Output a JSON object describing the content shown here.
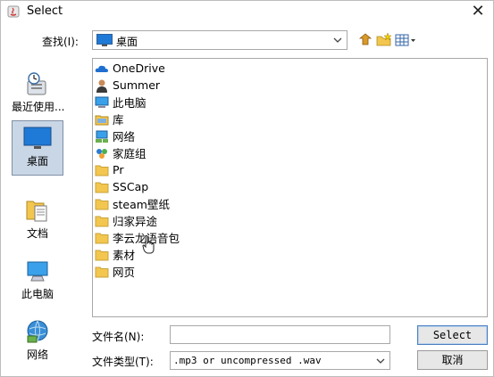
{
  "window": {
    "title": "Select",
    "close_label": "✕"
  },
  "look_in": {
    "label": "查找(I):",
    "value": "桌面",
    "icon": "desktop-icon"
  },
  "toolbar": {
    "icons": [
      "up-folder-icon",
      "new-folder-icon",
      "view-menu-icon"
    ]
  },
  "sidebar": {
    "items": [
      {
        "label": "最近使用...",
        "icon": "recent-icon"
      },
      {
        "label": "桌面",
        "icon": "desktop-icon"
      },
      {
        "label": "文档",
        "icon": "documents-icon"
      },
      {
        "label": "此电脑",
        "icon": "computer-icon"
      },
      {
        "label": "网络",
        "icon": "network-icon"
      }
    ],
    "selected": "桌面"
  },
  "files": [
    {
      "label": "OneDrive",
      "icon": "cloud-icon"
    },
    {
      "label": "Summer",
      "icon": "user-icon"
    },
    {
      "label": "此电脑",
      "icon": "computer-icon"
    },
    {
      "label": "库",
      "icon": "library-icon"
    },
    {
      "label": "网络",
      "icon": "network-icon"
    },
    {
      "label": "家庭组",
      "icon": "homegroup-icon"
    },
    {
      "label": "Pr",
      "icon": "folder-icon"
    },
    {
      "label": "SSCap",
      "icon": "folder-icon"
    },
    {
      "label": "steam壁纸",
      "icon": "folder-icon"
    },
    {
      "label": "归家异途",
      "icon": "folder-icon"
    },
    {
      "label": "李云龙语音包",
      "icon": "folder-icon"
    },
    {
      "label": "素材",
      "icon": "folder-icon"
    },
    {
      "label": "网页",
      "icon": "folder-icon"
    }
  ],
  "filename": {
    "label": "文件名(N):",
    "value": "",
    "placeholder": ""
  },
  "filetype": {
    "label": "文件类型(T):",
    "value": ".mp3 or uncompressed .wav"
  },
  "buttons": {
    "select": "Select",
    "cancel": "取消"
  },
  "colors": {
    "folder": "#f3c64f",
    "selection_bg": "#c9d6e6",
    "accent": "#4a7fc0"
  }
}
